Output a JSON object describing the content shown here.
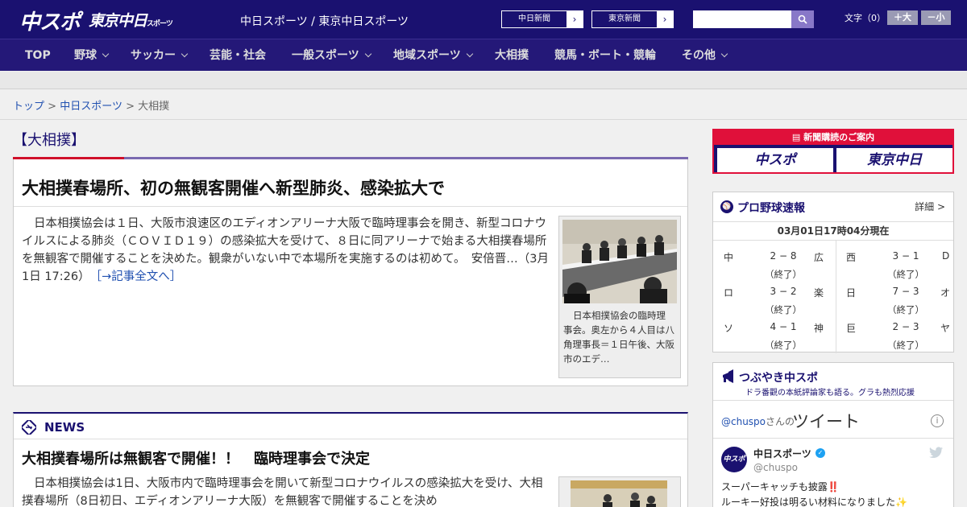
{
  "header": {
    "logo_chuspo": "中スポ",
    "logo_tokyo": "東京中日",
    "logo_tokyo_sub": "スポーツ",
    "site_title": "中日スポーツ / 東京中日スポーツ",
    "btn_chunichi": "中日新聞",
    "btn_tokyo": "東京新聞",
    "arrow": "›",
    "search_placeholder": "",
    "font_label": "文字（0）",
    "font_big": "＋大",
    "font_small": "－小"
  },
  "nav": {
    "items": [
      {
        "label": "TOP"
      },
      {
        "label": "野球"
      },
      {
        "label": "サッカー"
      },
      {
        "label": "芸能・社会"
      },
      {
        "label": "一般スポーツ"
      },
      {
        "label": "地域スポーツ"
      },
      {
        "label": "大相撲"
      },
      {
        "label": "競馬・ボート・競輪"
      },
      {
        "label": "その他"
      }
    ]
  },
  "breadcrumb": {
    "home": "トップ",
    "sep": ">",
    "section": "中日スポーツ",
    "current": "大相撲"
  },
  "section_title": "【大相撲】",
  "article1": {
    "title": "大相撲春場所、初の無観客開催へ新型肺炎、感染拡大で",
    "body": "日本相撲協会は１日、大阪市浪速区のエディオンアリーナ大阪で臨時理事会を開き、新型コロナウイルスによる肺炎（ＣＯＶＩＤ１９）の感染拡大を受けて、８日に同アリーナで始まる大相撲春場所を無観客で開催することを決めた。観衆がいない中で本場所を実施するのは初めて。　安倍晋…（3月1日 17:26）　",
    "more": "［→記事全文へ］",
    "caption": "日本相撲協会の臨時理事会。奥左から４人目は八角理事長＝１日午後、大阪市のエデ…"
  },
  "news": {
    "heading": "NEWS",
    "title": "大相撲春場所は無観客で開催！！　臨時理事会で決定",
    "body": "日本相撲協会は1日、大阪市内で臨時理事会を開いて新型コロナウイルスの感染拡大を受け、大相撲春場所（8日初日、エディオンアリーナ大阪）を無観客で開催することを決め"
  },
  "subscribe": {
    "heading": "新聞購読のご案内",
    "chuspo": "中スポ",
    "tokyo": "東京中日"
  },
  "baseball": {
    "title": "プロ野球速報",
    "detail": "詳細 >",
    "time": "03月01日17時04分現在",
    "games": [
      {
        "t1": "中",
        "score": "2 − 8",
        "status": "（終了）",
        "t2": "広"
      },
      {
        "t1": "西",
        "score": "3 − 1",
        "status": "（終了）",
        "t2": "D"
      },
      {
        "t1": "ロ",
        "score": "3 − 2",
        "status": "（終了）",
        "t2": "楽"
      },
      {
        "t1": "日",
        "score": "7 − 3",
        "status": "（終了）",
        "t2": "オ"
      },
      {
        "t1": "ソ",
        "score": "4 − 1",
        "status": "（終了）",
        "t2": "神"
      },
      {
        "t1": "巨",
        "score": "2 − 3",
        "status": "（終了）",
        "t2": "ヤ"
      }
    ]
  },
  "tweet": {
    "title": "つぶやき中スポ",
    "subtitle": "ドラ番觀の本紙評論家も語る。グラも熱烈応援",
    "handle": "@chuspo",
    "handle_suffix": "さんの",
    "label": "ツイート",
    "info": "i",
    "avatar": "中スポ",
    "name": "中日スポーツ",
    "verified": "✓",
    "id": "@chuspo",
    "text1": "スーパーキャッチも披露‼️",
    "text2": "ルーキー好投は明るい材料になりました✨"
  },
  "colors": {
    "header": "#1a1170",
    "accent_red": "#d0102a",
    "link": "#2050b0"
  }
}
